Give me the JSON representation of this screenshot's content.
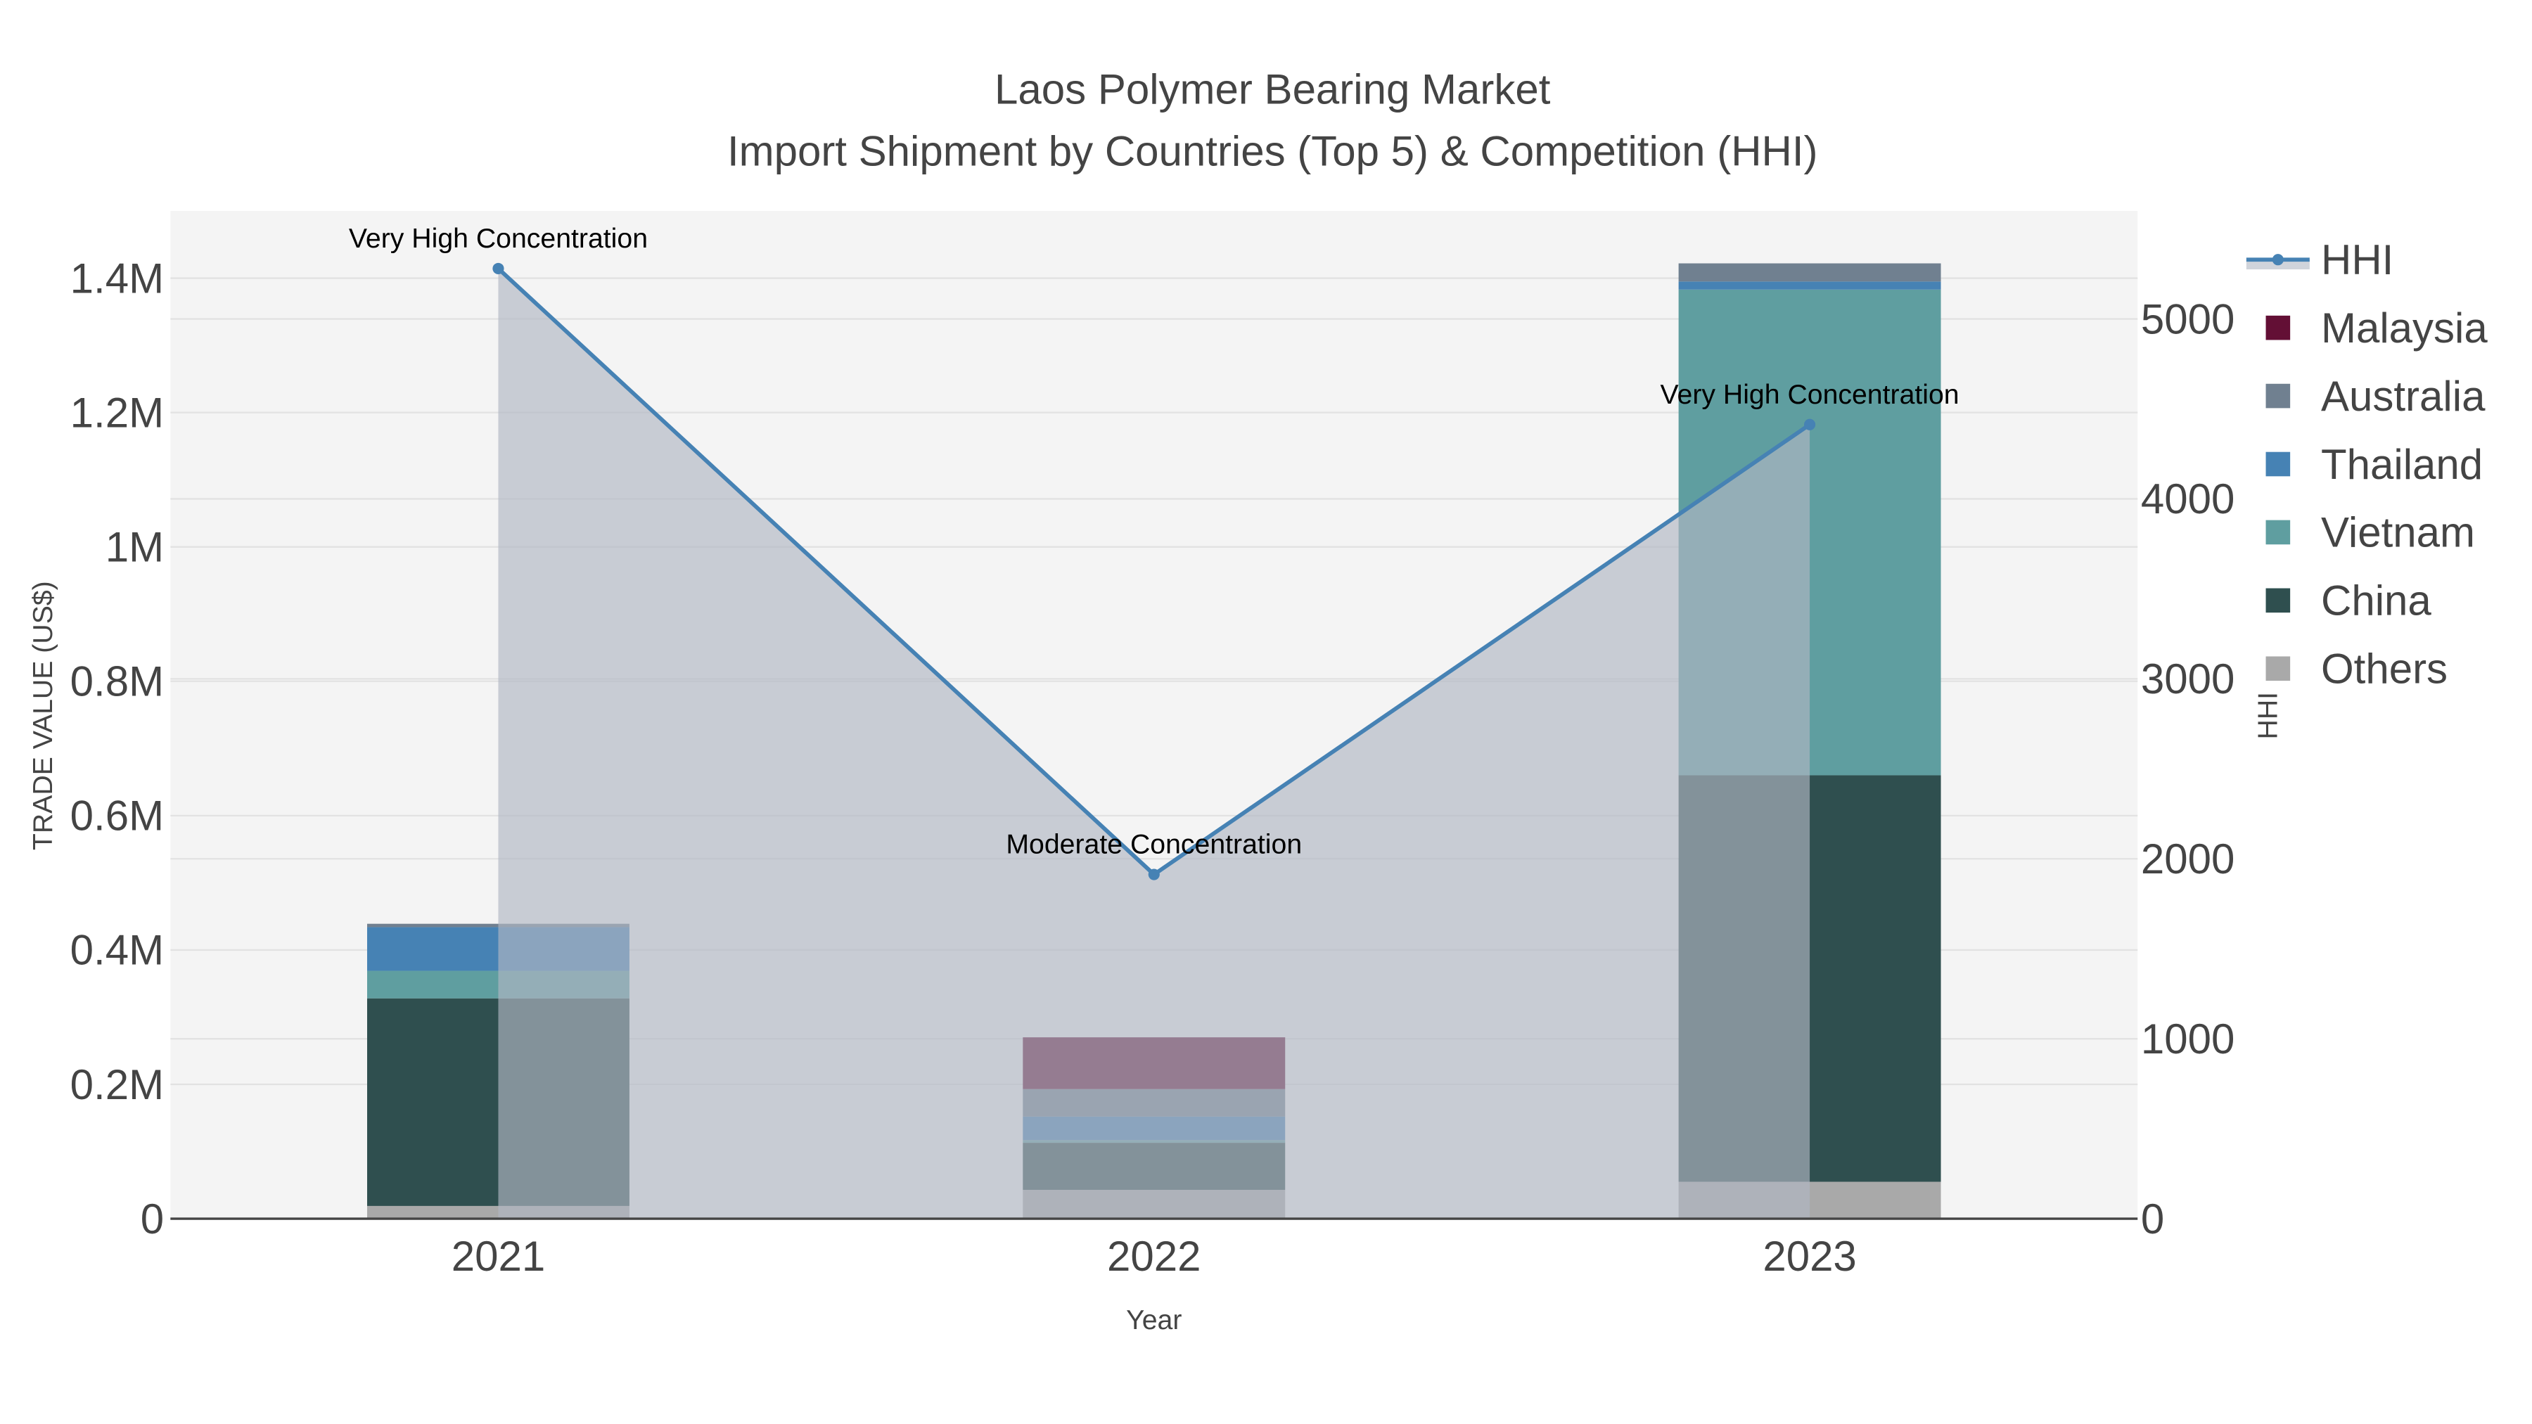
{
  "chart_data": {
    "type": "bar",
    "barmode": "stack",
    "title": "Laos Polymer Bearing Market",
    "subtitle": "Import Shipment by Countries (Top 5) & Competition (HHI)",
    "xlabel": "Year",
    "ylabel": "TRADE VALUE (US$)",
    "y2label": "HHI",
    "categories": [
      "2021",
      "2022",
      "2023"
    ],
    "ylim": [
      0,
      1500000
    ],
    "y_ticks": [
      0,
      200000,
      400000,
      600000,
      800000,
      1000000,
      1200000,
      1400000
    ],
    "y_tick_labels": [
      "0",
      "0.2M",
      "0.4M",
      "0.6M",
      "0.8M",
      "1M",
      "1.2M",
      "1.4M"
    ],
    "y2lim": [
      0,
      5600
    ],
    "y2_ticks": [
      0,
      1000,
      2000,
      3000,
      4000,
      5000
    ],
    "y2_tick_labels": [
      "0",
      "1000",
      "2000",
      "3000",
      "4000",
      "5000"
    ],
    "grid": true,
    "legend_position": "right",
    "series": [
      {
        "name": "Others",
        "color": "#A9A9A9",
        "values": [
          19000,
          43000,
          55000
        ]
      },
      {
        "name": "China",
        "color": "#2F4F4F",
        "values": [
          309000,
          70000,
          605000
        ]
      },
      {
        "name": "Vietnam",
        "color": "#5F9EA0",
        "values": [
          41000,
          4000,
          723000
        ]
      },
      {
        "name": "Thailand",
        "color": "#4682B4",
        "values": [
          65000,
          35000,
          12000
        ]
      },
      {
        "name": "Australia",
        "color": "#708090",
        "values": [
          5000,
          41000,
          27000
        ]
      },
      {
        "name": "Malaysia",
        "color": "#630F35",
        "values": [
          0,
          77000,
          0
        ]
      }
    ],
    "legend_order": [
      "HHI",
      "Malaysia",
      "Australia",
      "Thailand",
      "Vietnam",
      "China",
      "Others"
    ],
    "hhi": {
      "name": "HHI",
      "color": "#4682B4",
      "fill_color": "#B0B7C3",
      "values": [
        5280,
        1913,
        4413
      ],
      "annotations": [
        "Very High Concentration",
        "Moderate Concentration",
        "Very High Concentration"
      ]
    }
  }
}
